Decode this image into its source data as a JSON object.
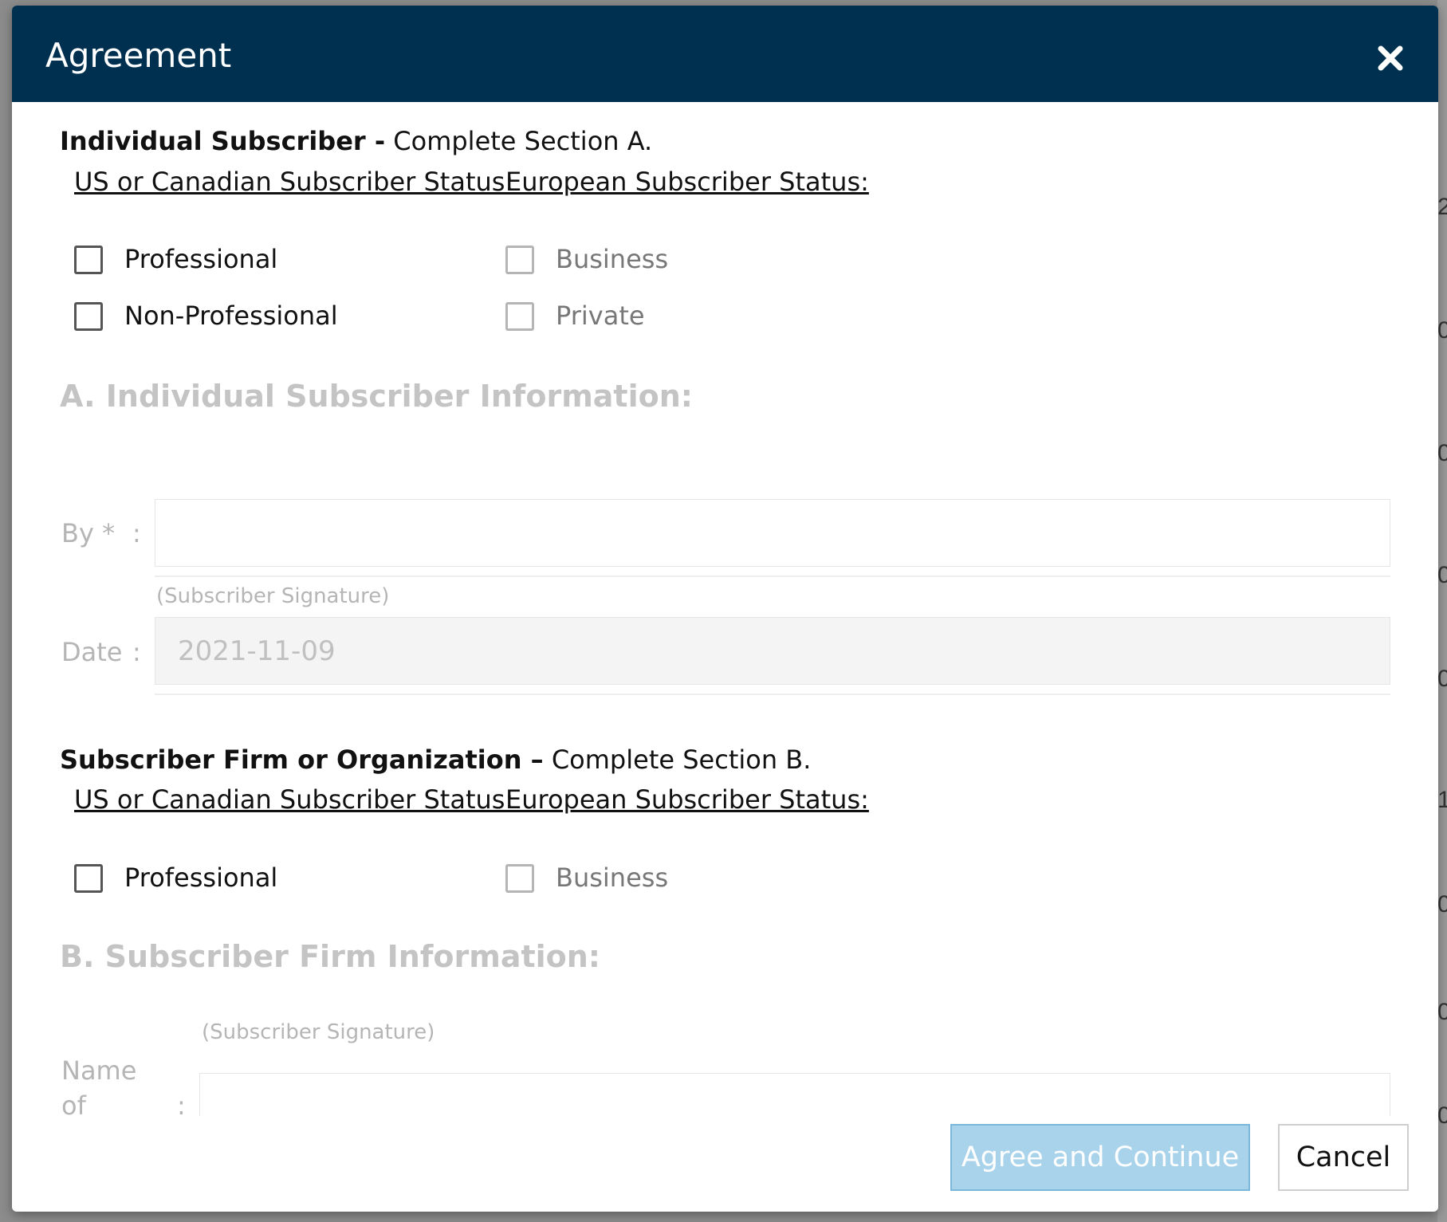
{
  "dialog": {
    "title": "Agreement",
    "close_icon": "close-icon"
  },
  "section_a": {
    "heading_bold": "Individual Subscriber -",
    "heading_rest": " Complete Section A.",
    "us_status_label": "US or Canadian Subscriber Status:",
    "eu_status_label": "European Subscriber Status:",
    "us_options": [
      {
        "label": "Professional",
        "checked": false
      },
      {
        "label": "Non-Professional",
        "checked": false
      }
    ],
    "eu_options": [
      {
        "label": "Business",
        "checked": false
      },
      {
        "label": "Private",
        "checked": false
      }
    ],
    "info_title": "A. Individual Subscriber Information:",
    "by_label": "By *",
    "colon": ":",
    "by_value": "",
    "signature_hint": "(Subscriber Signature)",
    "date_label": "Date",
    "date_value": "2021-11-09"
  },
  "section_b": {
    "heading_bold": "Subscriber Firm or Organization –",
    "heading_rest": " Complete Section B.",
    "us_status_label": "US or Canadian Subscriber Status:",
    "eu_status_label": "European Subscriber Status:",
    "us_options": [
      {
        "label": "Professional",
        "checked": false
      }
    ],
    "eu_options": [
      {
        "label": "Business",
        "checked": false
      }
    ],
    "info_title": "B. Subscriber Firm Information:",
    "signature_hint": "(Subscriber Signature)",
    "name_label_line1": "Name",
    "name_label_line2": "of",
    "colon": ":",
    "name_value": ""
  },
  "footer": {
    "agree_label": "Agree and Continue",
    "cancel_label": "Cancel"
  },
  "colors": {
    "header_bg": "#003050",
    "agree_bg": "#a9d3eb",
    "disabled_text": "#b5b5b5"
  },
  "background_edge_glyphs": [
    "2",
    "0",
    "0",
    "0",
    "0",
    "1",
    "0",
    "0",
    "0"
  ]
}
